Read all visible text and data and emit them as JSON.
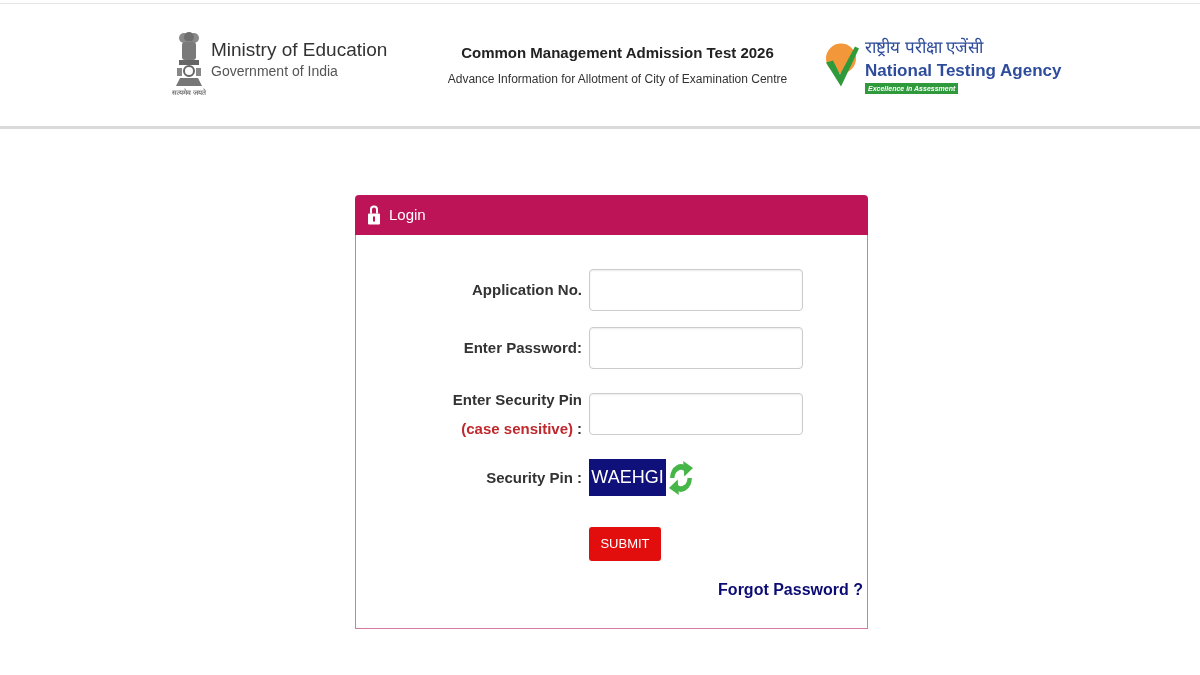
{
  "header": {
    "ministry": {
      "title": "Ministry of Education",
      "subtitle": "Government of India",
      "motto": "सत्यमेव जयते"
    },
    "exam": {
      "title": "Common Management Admission Test 2026",
      "subtitle": "Advance Information for Allotment of City of Examination Centre"
    },
    "agency": {
      "hindi_name": "राष्ट्रीय परीक्षा एजेंसी",
      "name": "National Testing Agency",
      "tagline": "Excellence in Assessment"
    }
  },
  "login_panel": {
    "title": "Login",
    "fields": [
      {
        "kind": "input",
        "label": "Application No."
      },
      {
        "kind": "input",
        "label": "Enter Password:"
      },
      {
        "kind": "input",
        "label": "Enter Security Pin",
        "note": "(case sensitive)",
        "suffix": ":"
      },
      {
        "kind": "captcha",
        "label": "Security Pin :",
        "captcha": "WAEHGI"
      }
    ],
    "submit": "SUBMIT",
    "forgot_link": "Forgot Password ?"
  }
}
